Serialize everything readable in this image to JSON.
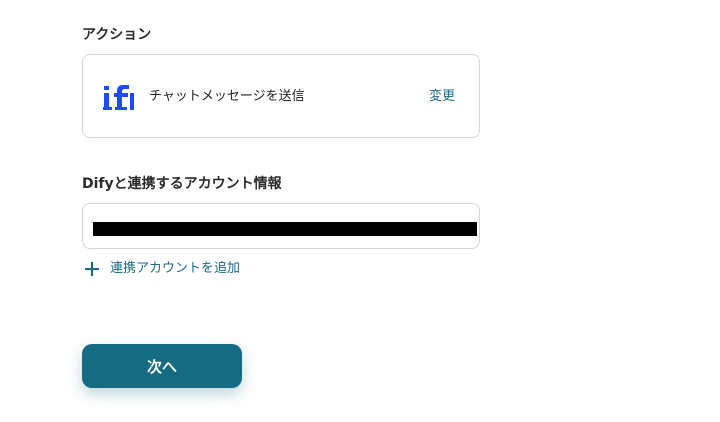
{
  "colors": {
    "accent": "#146b82",
    "link": "#1d6a83",
    "logo": "#1e4bff",
    "border": "#d5d5d5"
  },
  "action_section": {
    "label": "アクション",
    "app_icon": "dify-logo-icon",
    "action_name": "チャットメッセージを送信",
    "change_label": "変更"
  },
  "account_section": {
    "label": "Difyと連携するアカウント情報",
    "selected_account": "",
    "add_account_label": "連携アカウントを追加",
    "add_icon": "plus-icon"
  },
  "footer": {
    "next_label": "次へ"
  }
}
